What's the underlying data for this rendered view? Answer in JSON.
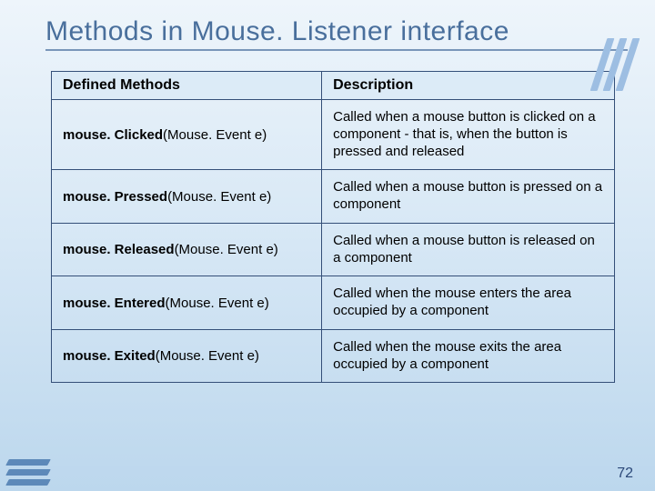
{
  "slide": {
    "title": "Methods in Mouse. Listener interface",
    "page_number": "72"
  },
  "table": {
    "headers": {
      "method": "Defined Methods",
      "description": "Description"
    },
    "rows": [
      {
        "method_bold": "mouse. Clicked",
        "method_rest": "(Mouse. Event e)",
        "description": "Called when a mouse button is clicked on a component - that is, when the button is pressed and released"
      },
      {
        "method_bold": "mouse. Pressed",
        "method_rest": "(Mouse. Event e)",
        "description": "Called when a mouse button is pressed on a component"
      },
      {
        "method_bold": "mouse. Released",
        "method_rest": "(Mouse. Event e)",
        "description": "Called when a mouse button is released on a component"
      },
      {
        "method_bold": "mouse. Entered",
        "method_rest": "(Mouse. Event e)",
        "description": "Called when the mouse enters the area occupied by a component"
      },
      {
        "method_bold": "mouse. Exited",
        "method_rest": "(Mouse. Event e)",
        "description": "Called when the mouse exits the area occupied by a component"
      }
    ]
  }
}
